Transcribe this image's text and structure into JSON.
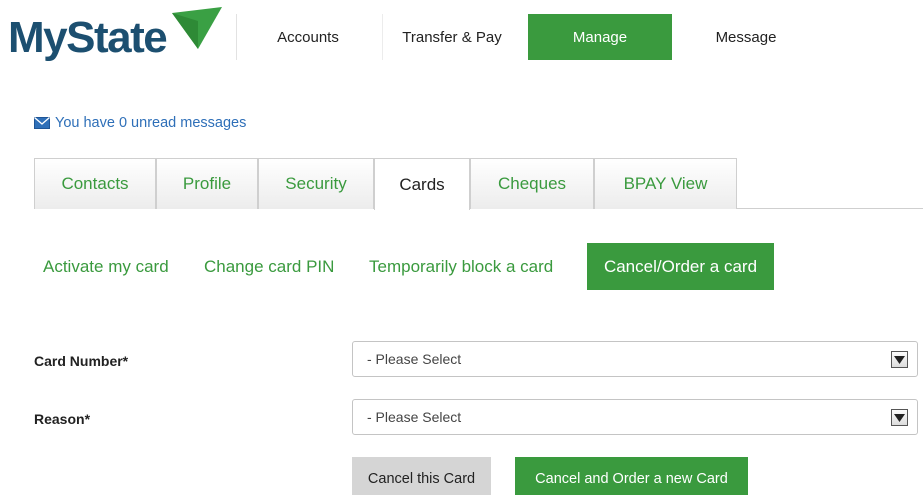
{
  "brand": {
    "name": "MyState",
    "accent": "#3a9a3e",
    "logo_text_color": "#1c4f70",
    "link_color": "#2e6fb8"
  },
  "nav": {
    "items": [
      {
        "label": "Accounts",
        "active": false
      },
      {
        "label": "Transfer & Pay",
        "active": false
      },
      {
        "label": "Manage",
        "active": true
      },
      {
        "label": "Message",
        "active": false
      }
    ]
  },
  "messages": {
    "icon": "envelope-icon",
    "text": "You have 0 unread messages"
  },
  "tabs": [
    {
      "label": "Contacts",
      "active": false
    },
    {
      "label": "Profile",
      "active": false
    },
    {
      "label": "Security",
      "active": false
    },
    {
      "label": "Cards",
      "active": true
    },
    {
      "label": "Cheques",
      "active": false
    },
    {
      "label": "BPAY View",
      "active": false
    }
  ],
  "submenu": [
    {
      "label": "Activate my card",
      "active": false
    },
    {
      "label": "Change card PIN",
      "active": false
    },
    {
      "label": "Temporarily block a card",
      "active": false
    },
    {
      "label": "Cancel/Order a card",
      "active": true
    }
  ],
  "form": {
    "card_number": {
      "label": "Card Number*",
      "value": "- Please Select"
    },
    "reason": {
      "label": "Reason*",
      "value": "- Please Select"
    }
  },
  "buttons": {
    "cancel_card": "Cancel this Card",
    "cancel_and_order": "Cancel and Order a new Card"
  }
}
